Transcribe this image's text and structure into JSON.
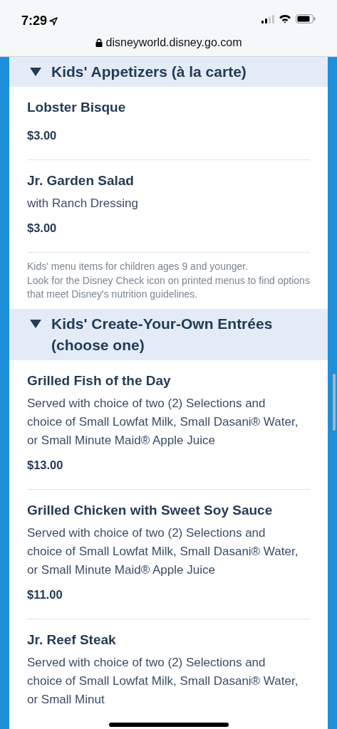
{
  "status_bar": {
    "time": "7:29"
  },
  "address_bar": {
    "url": "disneyworld.disney.go.com"
  },
  "sections": [
    {
      "title": "Kids' Appetizers (à la carte)",
      "expanded": true,
      "items": [
        {
          "name": "Lobster Bisque",
          "price": "$3.00"
        },
        {
          "name": "Jr. Garden Salad",
          "description": "with Ranch Dressing",
          "price": "$3.00"
        }
      ],
      "note": [
        "Kids' menu items for children ages 9 and younger.",
        "Look for the Disney Check icon on printed menus to find options that meet Disney's nutrition guidelines."
      ]
    },
    {
      "title": "Kids' Create-Your-Own Entrées (choose one)",
      "expanded": true,
      "items": [
        {
          "name": "Grilled Fish of the Day",
          "description": "Served with choice of two (2) Selections and choice of Small Lowfat Milk, Small Dasani® Water, or Small Minute Maid® Apple Juice",
          "price": "$13.00"
        },
        {
          "name": "Grilled Chicken with Sweet Soy Sauce",
          "description": "Served with choice of two (2) Selections and choice of Small Lowfat Milk, Small Dasani® Water, or Small Minute Maid® Apple Juice",
          "price": "$11.00"
        },
        {
          "name": "Jr. Reef Steak",
          "description": "Served with choice of two (2) Selections and choice of Small Lowfat Milk, Small Dasani® Water, or Small Minut"
        }
      ]
    }
  ]
}
